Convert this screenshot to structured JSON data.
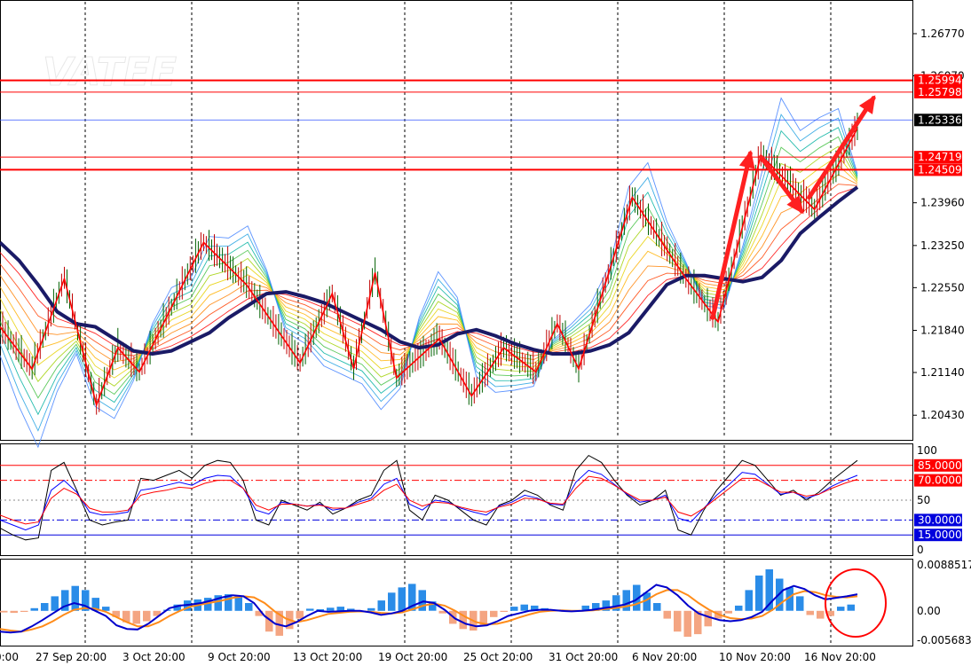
{
  "watermark": "VATEE",
  "colors": {
    "level_line": "#ff0000",
    "current_line": "#3355ff",
    "ma_thick": "#1a1a66",
    "price_tag_bg": "#ff0000",
    "current_tag_bg": "#000000",
    "osc_blue_tag": "#0000dd",
    "hist_up": "#2a8ce8",
    "hist_down": "#f4a582",
    "signal_orange": "#ff8c1a",
    "macd_line": "#0000cc",
    "circle": "#ff0000"
  },
  "chart_data": [
    {
      "type": "line",
      "panel": "price",
      "y_ticks": [
        "1.26770",
        "1.26070",
        "1.23960",
        "1.23250",
        "1.22550",
        "1.21840",
        "1.21140",
        "1.20430"
      ],
      "ylim": [
        1.2005,
        1.273
      ],
      "levels": [
        {
          "label": "1.25994",
          "value": 1.25994
        },
        {
          "label": "1.25798",
          "value": 1.25798
        },
        {
          "label": "1.24719",
          "value": 1.24719
        },
        {
          "label": "1.24509",
          "value": 1.24509
        }
      ],
      "current_price": {
        "label": "1.25336",
        "value": 1.25336
      },
      "x_labels": [
        "27 Sep 20:00",
        "3 Oct 20:00",
        "9 Oct 20:00",
        "13 Oct 20:00",
        "19 Oct 20:00",
        "25 Oct 20:00",
        "31 Oct 20:00",
        "6 Nov 20:00",
        "10 Nov 20:00",
        "16 Nov 20:00"
      ],
      "ma_series": {
        "name": "",
        "values": [
          1.233,
          1.23,
          1.226,
          1.2215,
          1.2195,
          1.219,
          1.217,
          1.215,
          1.2145,
          1.215,
          1.2165,
          1.218,
          1.2205,
          1.2225,
          1.2245,
          1.2248,
          1.224,
          1.223,
          1.2215,
          1.22,
          1.2185,
          1.2165,
          1.2155,
          1.216,
          1.2178,
          1.2185,
          1.2175,
          1.2162,
          1.2152,
          1.2145,
          1.2145,
          1.215,
          1.216,
          1.218,
          1.222,
          1.226,
          1.2275,
          1.2275,
          1.227,
          1.2265,
          1.2272,
          1.23,
          1.2345,
          1.2372,
          1.2398,
          1.2422
        ]
      },
      "zigzag": [
        [
          0,
          1.219
        ],
        [
          3,
          1.212
        ],
        [
          6,
          1.227
        ],
        [
          9,
          1.206
        ],
        [
          11,
          1.2155
        ],
        [
          13,
          1.2115
        ],
        [
          19,
          1.233
        ],
        [
          23,
          1.226
        ],
        [
          28,
          1.213
        ],
        [
          31,
          1.2245
        ],
        [
          33,
          1.212
        ],
        [
          35,
          1.228
        ],
        [
          37,
          1.2105
        ],
        [
          41,
          1.217
        ],
        [
          44,
          1.2075
        ],
        [
          47,
          1.2155
        ],
        [
          50,
          1.2115
        ],
        [
          52,
          1.2195
        ],
        [
          54,
          1.212
        ],
        [
          59,
          1.2405
        ],
        [
          64,
          1.227
        ],
        [
          67,
          1.2198
        ],
        [
          71,
          1.2475
        ],
        [
          76,
          1.2385
        ],
        [
          80,
          1.252
        ]
      ],
      "arrows": [
        {
          "from": [
            66.5,
            1.2205
          ],
          "to": [
            70,
            1.2478
          ]
        },
        {
          "from": [
            71,
            1.2472
          ],
          "to": [
            74.8,
            1.2382
          ]
        },
        {
          "from": [
            75.5,
            1.2405
          ],
          "to": [
            81.5,
            1.257
          ]
        }
      ],
      "x_count": 82
    },
    {
      "type": "line",
      "panel": "stochastic",
      "y_ticks": [
        "100",
        "50",
        "0"
      ],
      "ylim": [
        0,
        100
      ],
      "levels": [
        {
          "label": "85.0000",
          "value": 85,
          "color": "#ff0000"
        },
        {
          "label": "70.0000",
          "value": 70,
          "color": "#ff0000"
        },
        {
          "label": "30.0000",
          "value": 30,
          "color": "#0000dd"
        },
        {
          "label": "15.0000",
          "value": 15,
          "color": "#0000dd"
        }
      ],
      "series": [
        {
          "name": "",
          "color": "#000000",
          "values": [
            22,
            15,
            10,
            12,
            80,
            88,
            60,
            30,
            25,
            28,
            30,
            72,
            70,
            75,
            80,
            72,
            85,
            90,
            88,
            70,
            30,
            25,
            50,
            45,
            40,
            48,
            36,
            42,
            50,
            55,
            80,
            90,
            40,
            30,
            55,
            50,
            40,
            30,
            25,
            45,
            50,
            60,
            55,
            45,
            40,
            80,
            95,
            88,
            70,
            55,
            45,
            50,
            60,
            20,
            15,
            40,
            60,
            75,
            90,
            85,
            70,
            55,
            60,
            50,
            58,
            70,
            80,
            90
          ]
        },
        {
          "name": "",
          "color": "#0000ff",
          "values": [
            30,
            25,
            20,
            25,
            60,
            70,
            58,
            38,
            35,
            36,
            38,
            60,
            62,
            65,
            68,
            65,
            72,
            75,
            74,
            62,
            40,
            36,
            48,
            46,
            44,
            46,
            40,
            42,
            48,
            52,
            66,
            72,
            46,
            40,
            50,
            48,
            42,
            38,
            35,
            44,
            48,
            55,
            52,
            46,
            45,
            68,
            80,
            76,
            66,
            56,
            48,
            50,
            55,
            32,
            28,
            42,
            55,
            66,
            78,
            76,
            66,
            56,
            58,
            52,
            56,
            64,
            70,
            75
          ]
        },
        {
          "name": "",
          "color": "#ff0000",
          "values": [
            35,
            30,
            26,
            28,
            52,
            62,
            56,
            42,
            38,
            38,
            40,
            55,
            58,
            60,
            63,
            62,
            67,
            70,
            70,
            62,
            45,
            40,
            46,
            46,
            44,
            45,
            42,
            42,
            46,
            50,
            60,
            66,
            50,
            44,
            48,
            47,
            43,
            40,
            38,
            43,
            46,
            52,
            51,
            47,
            46,
            62,
            74,
            72,
            65,
            57,
            50,
            50,
            53,
            38,
            34,
            42,
            52,
            62,
            72,
            72,
            65,
            58,
            58,
            54,
            56,
            62,
            67,
            71
          ]
        }
      ]
    },
    {
      "type": "bar",
      "panel": "macd",
      "y_ticks": [
        "0.0088517",
        "0.00",
        "-0.005683"
      ],
      "ylim": [
        -0.005683,
        0.0088517
      ],
      "hist": [
        -0.0003,
        -0.0004,
        -0.0002,
        0.0005,
        0.0015,
        0.0028,
        0.004,
        0.0048,
        0.004,
        0.0025,
        0.0008,
        -0.0012,
        -0.0022,
        -0.0025,
        -0.002,
        -0.001,
        0.0002,
        0.0012,
        0.002,
        0.0022,
        0.0025,
        0.003,
        0.0032,
        0.0028,
        0.0015,
        -0.001,
        -0.004,
        -0.0048,
        -0.0035,
        -0.0015,
        0.0004,
        0.0003,
        0.0006,
        0.0008,
        0.0004,
        -0.0002,
        0.0005,
        0.002,
        0.0035,
        0.0045,
        0.0052,
        0.004,
        0.0018,
        -0.0005,
        -0.0025,
        -0.0035,
        -0.0038,
        -0.0028,
        -0.0012,
        -0.0002,
        0.0008,
        0.0012,
        0.001,
        0.0005,
        0.0001,
        -0.0002,
        -0.0001,
        0.001,
        0.0015,
        0.002,
        0.003,
        0.004,
        0.005,
        0.0035,
        0.0015,
        -0.0015,
        -0.004,
        -0.005,
        -0.0045,
        -0.003,
        -0.0015,
        -0.0005,
        0.001,
        0.004,
        0.0068,
        0.008,
        0.0062,
        0.0045,
        0.0028,
        -0.0008,
        -0.0015,
        -0.001,
        0.0008,
        0.0012
      ],
      "macd_line": [
        -0.004,
        -0.0042,
        -0.004,
        -0.003,
        -0.0018,
        -0.0005,
        0.0008,
        0.0015,
        0.001,
        0.0,
        -0.001,
        -0.0028,
        -0.0035,
        -0.0036,
        -0.0025,
        -0.001,
        0.0005,
        0.001,
        0.0012,
        0.0015,
        0.002,
        0.0026,
        0.003,
        0.0028,
        0.0015,
        -0.001,
        -0.0025,
        -0.003,
        -0.0022,
        -0.001,
        0.0,
        -0.0002,
        -0.0001,
        0.0,
        0.0,
        -0.0003,
        -0.0008,
        -0.0005,
        0.0,
        0.001,
        0.0018,
        0.0015,
        0.0002,
        -0.0015,
        -0.0025,
        -0.003,
        -0.0028,
        -0.002,
        -0.001,
        -0.0005,
        0.0,
        0.0002,
        0.0002,
        0.0,
        -0.0001,
        0.0,
        0.0002,
        0.0005,
        0.0008,
        0.0012,
        0.002,
        0.0035,
        0.005,
        0.0045,
        0.003,
        0.001,
        -0.0005,
        -0.0012,
        -0.0018,
        -0.002,
        -0.0018,
        -0.0012,
        -0.0002,
        0.002,
        0.004,
        0.0048,
        0.0042,
        0.003,
        0.0022,
        0.0025,
        0.0028,
        0.0032
      ],
      "signal_line": [
        -0.0035,
        -0.0038,
        -0.004,
        -0.0036,
        -0.003,
        -0.002,
        -0.0008,
        0.0002,
        0.0005,
        0.0004,
        -0.0002,
        -0.0012,
        -0.0022,
        -0.003,
        -0.003,
        -0.0022,
        -0.001,
        0.0,
        0.0008,
        0.0012,
        0.0016,
        0.002,
        0.0025,
        0.0028,
        0.0026,
        0.0015,
        -0.0002,
        -0.0015,
        -0.0022,
        -0.0018,
        -0.0012,
        -0.0006,
        -0.0004,
        -0.0002,
        -0.0001,
        -0.0002,
        -0.0004,
        -0.0005,
        -0.0003,
        0.0003,
        0.001,
        0.0014,
        0.001,
        0.0,
        -0.0012,
        -0.0022,
        -0.0026,
        -0.0025,
        -0.002,
        -0.0013,
        -0.0007,
        -0.0002,
        0.0,
        0.0001,
        0.0,
        0.0,
        0.0001,
        0.0003,
        0.0005,
        0.0008,
        0.0012,
        0.002,
        0.0032,
        0.004,
        0.004,
        0.003,
        0.0015,
        0.0002,
        -0.0008,
        -0.0014,
        -0.0016,
        -0.0015,
        -0.001,
        0.0002,
        0.0018,
        0.0032,
        0.0038,
        0.0036,
        0.003,
        0.0027,
        0.0026,
        0.0028
      ]
    }
  ]
}
